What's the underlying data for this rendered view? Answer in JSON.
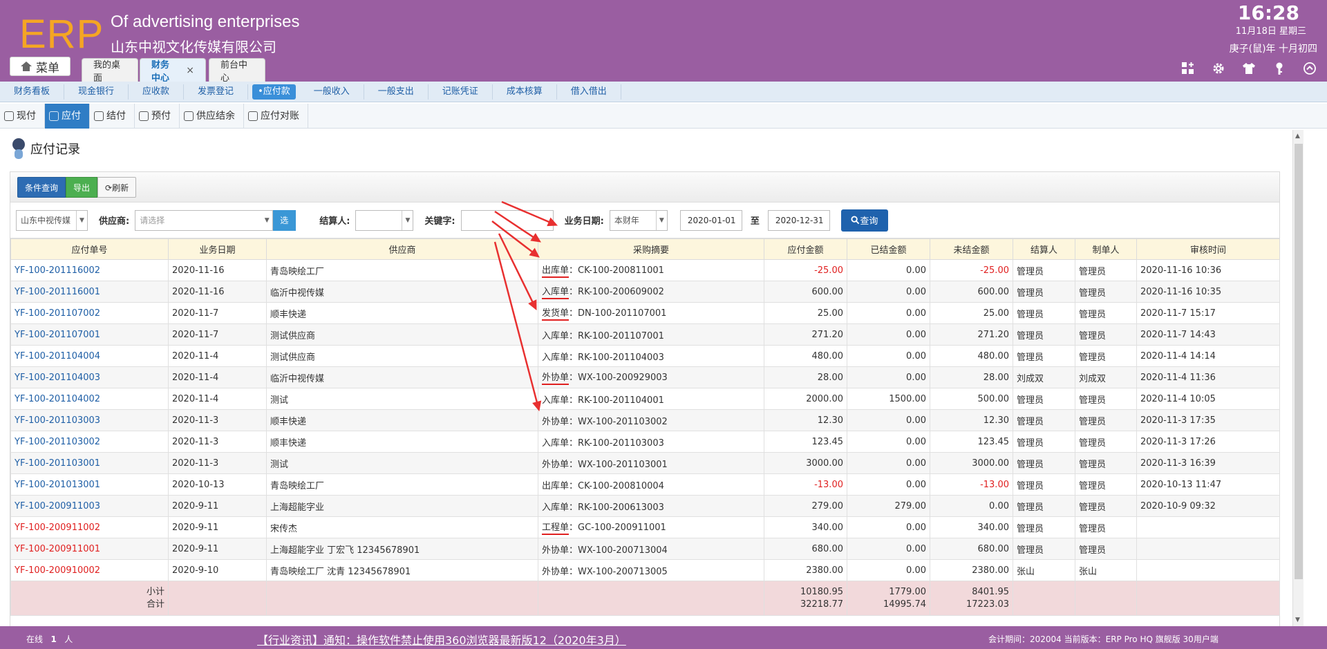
{
  "app": {
    "logo": "ERP",
    "company_en": "Of advertising enterprises",
    "company_cn": "山东中视文化传媒有限公司",
    "clock": "16:28",
    "date_line1": "11月18日 星期三",
    "date_line2": "庚子(鼠)年 十月初四",
    "menu_label": "菜单"
  },
  "top_tabs": [
    {
      "label": "我的桌面",
      "active": false
    },
    {
      "label": "财务中心",
      "active": true,
      "close": "×"
    },
    {
      "label": "前台中心",
      "active": false
    }
  ],
  "header_icons": [
    "grid-add-icon",
    "gear-icon",
    "shirt-icon",
    "key-icon",
    "collapse-up-icon"
  ],
  "submenu": [
    "财务看板",
    "现金银行",
    "应收款",
    "发票登记",
    "•应付款",
    "一般收入",
    "一般支出",
    "记账凭证",
    "成本核算",
    "借入借出"
  ],
  "submenu_active": 4,
  "subtabs": [
    "现付",
    "应付",
    "结付",
    "预付",
    "供应结余",
    "应付对账"
  ],
  "subtabs_active": 1,
  "page": {
    "title": "应付记录"
  },
  "toolbar": {
    "query": "条件查询",
    "export": "导出",
    "refresh": "刷新"
  },
  "filters": {
    "company": "山东中视传媒",
    "supplier_label": "供应商:",
    "supplier_placeholder": "请选择",
    "select_btn": "选",
    "settler_label": "结算人:",
    "keyword_label": "关键字:",
    "date_label": "业务日期:",
    "date_range": "本财年",
    "date_from": "2020-01-01",
    "to": "至",
    "date_to": "2020-12-31",
    "search_btn": "查询"
  },
  "table": {
    "headers": [
      "应付单号",
      "业务日期",
      "供应商",
      "采购摘要",
      "应付金额",
      "已结金额",
      "未结金额",
      "结算人",
      "制单人",
      "审核时间"
    ],
    "rows": [
      {
        "no": "YF-100-201116002",
        "date": "2020-11-16",
        "supplier": "青岛映绘工厂",
        "doc": "出库单",
        "ref": "CK-100-200811001",
        "amount": "-25.00",
        "paid": "0.00",
        "unpaid": "-25.00",
        "settler": "管理员",
        "maker": "管理员",
        "audit": "2020-11-16 10:36",
        "neg": true,
        "red": false,
        "mark": true
      },
      {
        "no": "YF-100-201116001",
        "date": "2020-11-16",
        "supplier": "临沂中视传媒",
        "doc": "入库单",
        "ref": "RK-100-200609002",
        "amount": "600.00",
        "paid": "0.00",
        "unpaid": "600.00",
        "settler": "管理员",
        "maker": "管理员",
        "audit": "2020-11-16 10:35",
        "neg": false,
        "red": false,
        "mark": true
      },
      {
        "no": "YF-100-201107002",
        "date": "2020-11-7",
        "supplier": "顺丰快递",
        "doc": "发货单",
        "ref": "DN-100-201107001",
        "amount": "25.00",
        "paid": "0.00",
        "unpaid": "25.00",
        "settler": "管理员",
        "maker": "管理员",
        "audit": "2020-11-7 15:17",
        "neg": false,
        "red": false,
        "mark": true
      },
      {
        "no": "YF-100-201107001",
        "date": "2020-11-7",
        "supplier": "测试供应商",
        "doc": "入库单",
        "ref": "RK-100-201107001",
        "amount": "271.20",
        "paid": "0.00",
        "unpaid": "271.20",
        "settler": "管理员",
        "maker": "管理员",
        "audit": "2020-11-7 14:43",
        "neg": false,
        "red": false,
        "mark": false
      },
      {
        "no": "YF-100-201104004",
        "date": "2020-11-4",
        "supplier": "测试供应商",
        "doc": "入库单",
        "ref": "RK-100-201104003",
        "amount": "480.00",
        "paid": "0.00",
        "unpaid": "480.00",
        "settler": "管理员",
        "maker": "管理员",
        "audit": "2020-11-4 14:14",
        "neg": false,
        "red": false,
        "mark": false
      },
      {
        "no": "YF-100-201104003",
        "date": "2020-11-4",
        "supplier": "临沂中视传媒",
        "doc": "外协单",
        "ref": "WX-100-200929003",
        "amount": "28.00",
        "paid": "0.00",
        "unpaid": "28.00",
        "settler": "刘成双",
        "maker": "刘成双",
        "audit": "2020-11-4 11:36",
        "neg": false,
        "red": false,
        "mark": true
      },
      {
        "no": "YF-100-201104002",
        "date": "2020-11-4",
        "supplier": "测试",
        "doc": "入库单",
        "ref": "RK-100-201104001",
        "amount": "2000.00",
        "paid": "1500.00",
        "unpaid": "500.00",
        "settler": "管理员",
        "maker": "管理员",
        "audit": "2020-11-4 10:05",
        "neg": false,
        "red": false,
        "mark": false
      },
      {
        "no": "YF-100-201103003",
        "date": "2020-11-3",
        "supplier": "顺丰快递",
        "doc": "外协单",
        "ref": "WX-100-201103002",
        "amount": "12.30",
        "paid": "0.00",
        "unpaid": "12.30",
        "settler": "管理员",
        "maker": "管理员",
        "audit": "2020-11-3 17:35",
        "neg": false,
        "red": false,
        "mark": false
      },
      {
        "no": "YF-100-201103002",
        "date": "2020-11-3",
        "supplier": "顺丰快递",
        "doc": "入库单",
        "ref": "RK-100-201103003",
        "amount": "123.45",
        "paid": "0.00",
        "unpaid": "123.45",
        "settler": "管理员",
        "maker": "管理员",
        "audit": "2020-11-3 17:26",
        "neg": false,
        "red": false,
        "mark": false
      },
      {
        "no": "YF-100-201103001",
        "date": "2020-11-3",
        "supplier": "测试",
        "doc": "外协单",
        "ref": "WX-100-201103001",
        "amount": "3000.00",
        "paid": "0.00",
        "unpaid": "3000.00",
        "settler": "管理员",
        "maker": "管理员",
        "audit": "2020-11-3 16:39",
        "neg": false,
        "red": false,
        "mark": false
      },
      {
        "no": "YF-100-201013001",
        "date": "2020-10-13",
        "supplier": "青岛映绘工厂",
        "doc": "出库单",
        "ref": "CK-100-200810004",
        "amount": "-13.00",
        "paid": "0.00",
        "unpaid": "-13.00",
        "settler": "管理员",
        "maker": "管理员",
        "audit": "2020-10-13 11:47",
        "neg": true,
        "red": false,
        "mark": false
      },
      {
        "no": "YF-100-200911003",
        "date": "2020-9-11",
        "supplier": "上海超能字业",
        "doc": "入库单",
        "ref": "RK-100-200613003",
        "amount": "279.00",
        "paid": "279.00",
        "unpaid": "0.00",
        "settler": "管理员",
        "maker": "管理员",
        "audit": "2020-10-9 09:32",
        "neg": false,
        "red": false,
        "mark": false
      },
      {
        "no": "YF-100-200911002",
        "date": "2020-9-11",
        "supplier": "宋传杰",
        "doc": "工程单",
        "ref": "GC-100-200911001",
        "amount": "340.00",
        "paid": "0.00",
        "unpaid": "340.00",
        "settler": "管理员",
        "maker": "管理员",
        "audit": "",
        "neg": false,
        "red": true,
        "mark": true
      },
      {
        "no": "YF-100-200911001",
        "date": "2020-9-11",
        "supplier": "上海超能字业 丁宏飞 12345678901",
        "doc": "外协单",
        "ref": "WX-100-200713004",
        "amount": "680.00",
        "paid": "0.00",
        "unpaid": "680.00",
        "settler": "管理员",
        "maker": "管理员",
        "audit": "",
        "neg": false,
        "red": true,
        "mark": false
      },
      {
        "no": "YF-100-200910002",
        "date": "2020-9-10",
        "supplier": "青岛映绘工厂 沈青 12345678901",
        "doc": "外协单",
        "ref": "WX-100-200713005",
        "amount": "2380.00",
        "paid": "0.00",
        "unpaid": "2380.00",
        "settler": "张山",
        "maker": "张山",
        "audit": "",
        "neg": false,
        "red": true,
        "mark": false
      }
    ],
    "subtotal_label": "小计",
    "total_label": "合计",
    "subtotal": {
      "amount": "10180.95",
      "paid": "1779.00",
      "unpaid": "8401.95"
    },
    "total": {
      "amount": "32218.77",
      "paid": "14995.74",
      "unpaid": "17223.03"
    }
  },
  "footer": {
    "online": "在线",
    "online_count": "1",
    "online_unit": "人",
    "news": "【行业资讯】通知：操作软件禁止使用360浏览器最新版12（2020年3月）",
    "info": "会计期间：202004 当前版本：ERP Pro HQ 旗舰版 30用户端"
  },
  "colors": {
    "header": "#9a5ea1",
    "logo": "#f5a623",
    "link": "#1f5fa6",
    "negative": "#e02020",
    "annotation": "#e02020"
  }
}
